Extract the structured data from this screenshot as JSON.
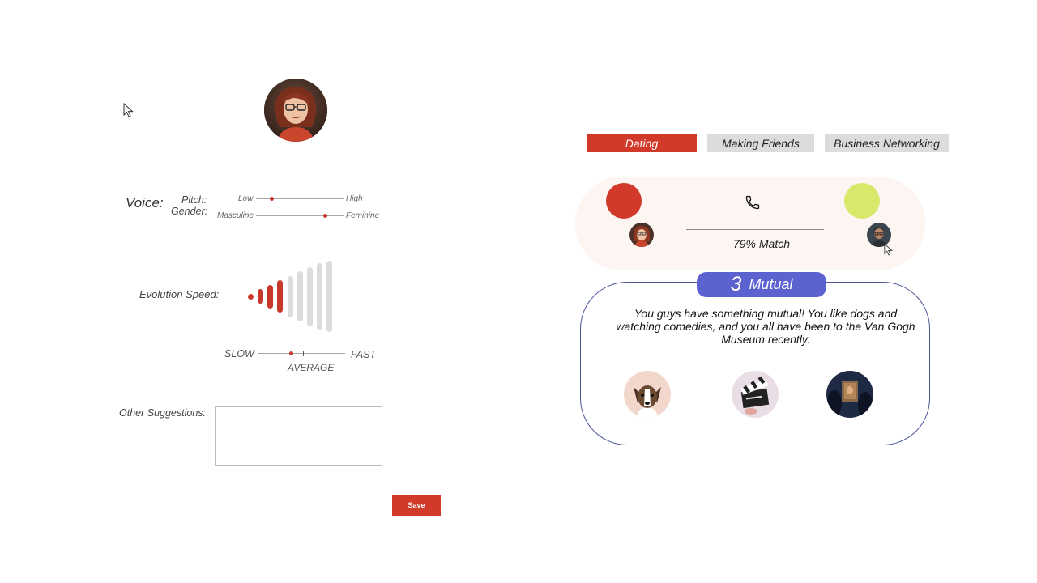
{
  "profile": {
    "avatar_icon": "woman-avatar-portrait"
  },
  "voice": {
    "label": "Voice:",
    "pitch": {
      "label": "Pitch:",
      "low": "Low",
      "high": "High",
      "value": 0.18
    },
    "gender": {
      "label": "Gender:",
      "low": "Masculine",
      "high": "Feminine",
      "value": 0.79
    }
  },
  "evolution": {
    "label": "Evolution Speed:",
    "slow": "SLOW",
    "fast": "FAST",
    "average": "AVERAGE",
    "level": 4,
    "total_bars": 9,
    "speed_value": 0.38,
    "active_color": "#c9392b",
    "inactive_color": "#dcdcdc"
  },
  "suggestions": {
    "label": "Other Suggestions:",
    "value": ""
  },
  "save": {
    "label": "Save"
  },
  "tabs": [
    {
      "label": "Dating",
      "active": true
    },
    {
      "label": "Making Friends",
      "active": false
    },
    {
      "label": "Business Networking",
      "active": false
    }
  ],
  "match": {
    "percent_label": "79% Match",
    "left_color": "#d13a2a",
    "right_color": "#d8e86a",
    "call_icon": "phone-icon"
  },
  "mutual": {
    "count": "3",
    "label": "Mutual",
    "description": "You guys have something mutual! You like dogs and watching comedies, and you all have been to the Van Gogh Museum recently.",
    "interests": [
      {
        "icon": "dog-icon"
      },
      {
        "icon": "clapperboard-icon"
      },
      {
        "icon": "museum-painting-icon"
      }
    ]
  },
  "colors": {
    "accent": "#d13a2a",
    "badge": "#5c63d1",
    "card_border": "#4a5598"
  }
}
